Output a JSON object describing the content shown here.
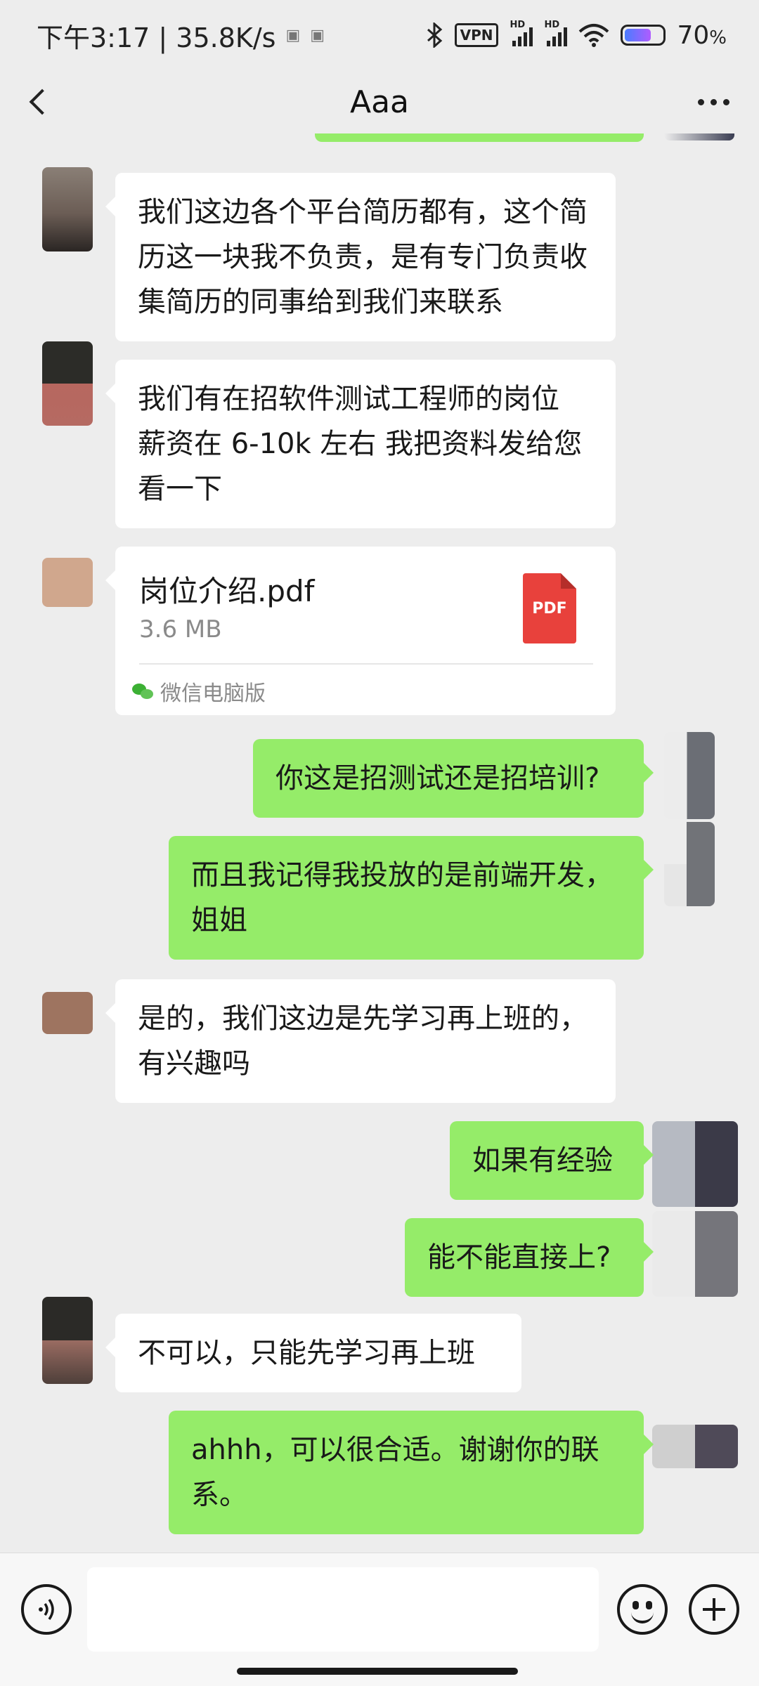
{
  "status_bar": {
    "time_speed": "下午3:17 | 35.8K/s",
    "vpn_label": "VPN",
    "hd_label": "HD",
    "battery_percent": "70",
    "battery_unit": "%",
    "battery_level": 0.7,
    "icons": [
      "notification-icon",
      "bluetooth-icon",
      "vpn-icon",
      "signal-icon",
      "wifi-icon",
      "battery-icon"
    ]
  },
  "header": {
    "title": "Aaa",
    "back_icon": "chevron-left-icon",
    "more_icon": "more-dots-icon"
  },
  "messages": [
    {
      "from": "them",
      "type": "text",
      "text": "我们这边各个平台简历都有，这个简历这一块我不负责，是有专门负责收集简历的同事给到我们来联系"
    },
    {
      "from": "them",
      "type": "text",
      "text": "我们有在招软件测试工程师的岗位 薪资在 6-10k 左右 我把资料发给您看一下"
    },
    {
      "from": "them",
      "type": "file",
      "file_name": "岗位介绍.pdf",
      "file_size": "3.6 MB",
      "file_badge": "PDF",
      "source": "微信电脑版"
    },
    {
      "from": "me",
      "type": "text",
      "text": "你这是招测试还是招培训?"
    },
    {
      "from": "me",
      "type": "text",
      "text": "而且我记得我投放的是前端开发，姐姐"
    },
    {
      "from": "them",
      "type": "text",
      "text": "是的，我们这边是先学习再上班的，有兴趣吗"
    },
    {
      "from": "me",
      "type": "text",
      "text": "如果有经验"
    },
    {
      "from": "me",
      "type": "text",
      "text": "能不能直接上?"
    },
    {
      "from": "them",
      "type": "text",
      "text": "不可以，只能先学习再上班"
    },
    {
      "from": "me",
      "type": "text",
      "text": "ahhh，可以很合适。谢谢你的联系。"
    }
  ],
  "input_bar": {
    "voice_icon": "voice-icon",
    "emoji_icon": "emoji-icon",
    "plus_icon": "plus-icon",
    "input_value": ""
  },
  "colors": {
    "background": "#ededed",
    "bubble_in": "#ffffff",
    "bubble_out": "#95ec69",
    "pdf_red": "#e8413c"
  }
}
